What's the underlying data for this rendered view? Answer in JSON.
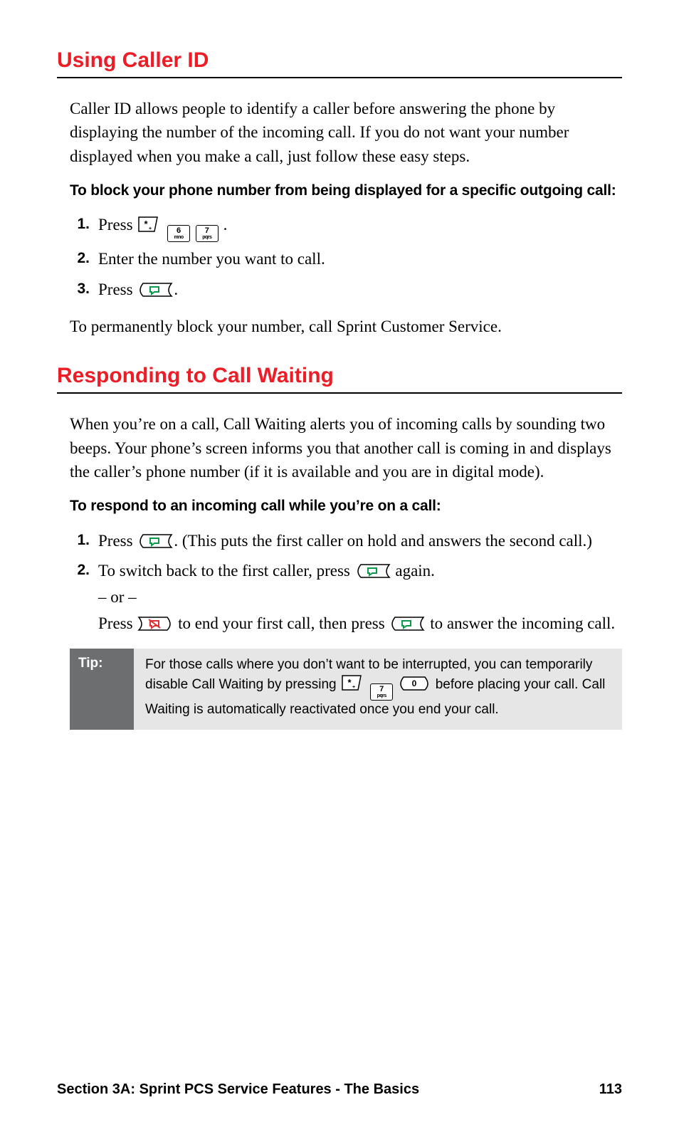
{
  "section1": {
    "heading": "Using Caller ID",
    "intro": "Caller ID allows people to identify a caller before answering the phone by displaying the number of the incoming call. If you do not want your number displayed when you make a call, just follow these easy steps.",
    "subhead": "To block your phone number from being displayed for a specific outgoing call:",
    "steps": {
      "s1_pre": "Press  ",
      "s1_post": " .",
      "s2": "Enter the number you want to call.",
      "s3_pre": "Press ",
      "s3_post": "."
    },
    "closing": "To permanently block your number, call Sprint Customer Service."
  },
  "section2": {
    "heading": "Responding to Call Waiting",
    "intro": "When you’re on a call, Call Waiting alerts you of incoming calls by sounding two beeps. Your phone’s screen informs you that another call is coming in and displays the caller’s phone number (if it is available and you are in digital mode).",
    "subhead": "To respond to an incoming call while you’re on a call:",
    "steps": {
      "s1_pre": "Press ",
      "s1_post": ". (This puts the first caller on hold and answers the second call.)",
      "s2_a_pre": "To switch back to the first caller, press ",
      "s2_a_post": " again.",
      "s2_or": "– or –",
      "s2_b_pre": "Press ",
      "s2_b_mid": " to end your first call, then press ",
      "s2_b_post": " to answer the incoming call."
    }
  },
  "tip": {
    "label": "Tip:",
    "text_pre": "For those calls where you don’t want to be interrupted, you can temporarily disable Call Waiting by pressing  ",
    "text_post": "  before placing your call. Call Waiting is automatically reactivated once you end your call."
  },
  "keys": {
    "k6_top": "6",
    "k6_bot": "mno",
    "k7_top": "7",
    "k7_bot": "pqrs",
    "k0_top": "0",
    "k0_bot": ""
  },
  "footer": {
    "left": "Section 3A: Sprint PCS Service Features - The Basics",
    "right": "113"
  }
}
